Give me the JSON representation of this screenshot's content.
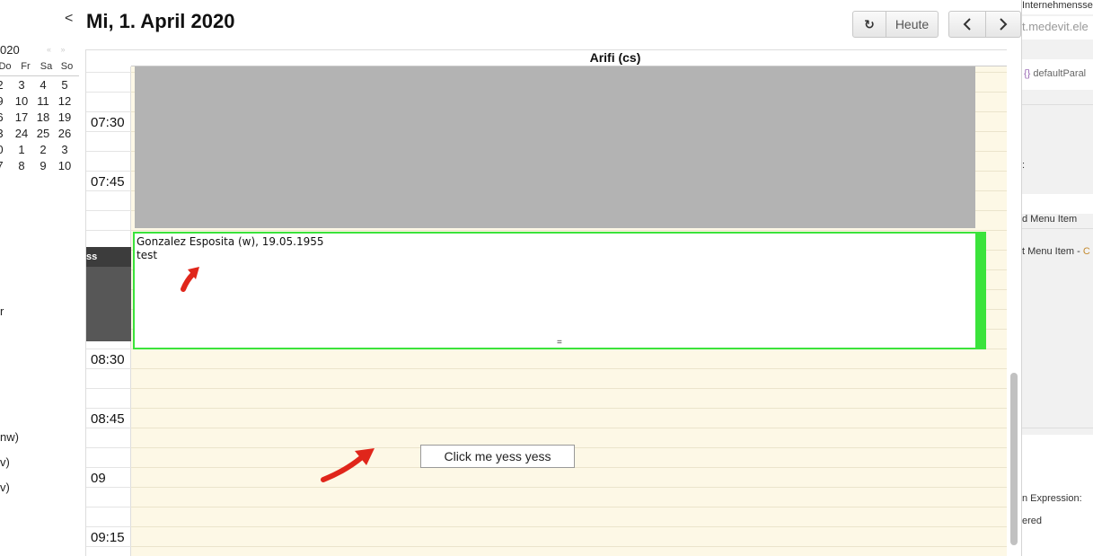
{
  "header": {
    "date_title": "Mi, 1. April 2020",
    "collapse_label": "<",
    "refresh_icon": "↻",
    "today_label": "Heute",
    "prev_label": "‹",
    "next_label": "›"
  },
  "mini_calendar": {
    "year_fragment": "020",
    "nav_fragment": "« »",
    "weekdays": [
      "Do",
      "Fr",
      "Sa",
      "So"
    ],
    "rows": [
      [
        "2",
        "3",
        "4",
        "5"
      ],
      [
        "9",
        "10",
        "11",
        "12"
      ],
      [
        "6",
        "17",
        "18",
        "19"
      ],
      [
        "3",
        "24",
        "25",
        "26"
      ],
      [
        "0",
        "1",
        "2",
        "3"
      ],
      [
        "7",
        "8",
        "9",
        "10"
      ]
    ]
  },
  "sidebar_fragments": [
    "r",
    "nw)",
    "v)",
    "v)"
  ],
  "calendar": {
    "resource": "Arifi (cs)",
    "time_labels": [
      "07:30",
      "07:45",
      "08:30",
      "08:45",
      "09",
      "09:15"
    ],
    "dark_block_label": "ss",
    "appointment": {
      "line1": "Gonzalez Esposita (w), 19.05.1955",
      "line2": "test",
      "handle": "="
    },
    "button_label": "Click me yess yess"
  },
  "right_panel": {
    "top_text": "Internehmensse",
    "url_text": "t.medevit.ele",
    "param_text": "defaultParal",
    "colon": ":",
    "menu_item_1": "d Menu Item",
    "menu_item_2": "t Menu Item -",
    "menu_item_2_suffix": "C",
    "expression": "n Expression:",
    "ered": "ered"
  },
  "colors": {
    "accent_green": "#3be33b",
    "day_background": "#fdf8e6",
    "blocked_gray": "#b3b3b3",
    "arrow_red": "#e0261b"
  }
}
